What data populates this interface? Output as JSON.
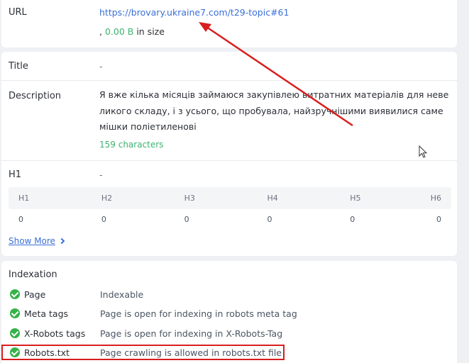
{
  "url_card": {
    "label": "URL",
    "url": "https://brovary.ukraine7.com/t29-topic#61",
    "size_prefix": ", ",
    "size_value": "0.00 B",
    "size_suffix": " in size"
  },
  "meta_card": {
    "title_label": "Title",
    "title_value": "-",
    "description_label": "Description",
    "description_value": "Я вже кілька місяців займаюся закупівлею витратних матеріалів для невеликого складу, і з усього, що пробувала, найзручнішими виявилися саме мішки поліетиленові",
    "description_count": "159 characters",
    "h1_label": "H1",
    "h1_value": "-",
    "headings_table": {
      "headers": [
        "H1",
        "H2",
        "H3",
        "H4",
        "H5",
        "H6"
      ],
      "values": [
        "0",
        "0",
        "0",
        "0",
        "0",
        "0"
      ]
    },
    "show_more": "Show More"
  },
  "indexation": {
    "title": "Indexation",
    "rows": [
      {
        "label": "Page",
        "value": "Indexable"
      },
      {
        "label": "Meta tags",
        "value": "Page is open for indexing in robots meta tag"
      },
      {
        "label": "X-Robots tags",
        "value": "Page is open for indexing in X-Robots-Tag"
      },
      {
        "label": "Robots.txt",
        "value": "Page crawling is allowed in robots.txt file"
      }
    ]
  },
  "colors": {
    "link": "#3a6fd8",
    "ok": "#36b24a",
    "annotation": "#d81e1e"
  },
  "icons": [
    "check-circle-icon",
    "chevron-right-icon",
    "mouse-cursor-icon"
  ]
}
